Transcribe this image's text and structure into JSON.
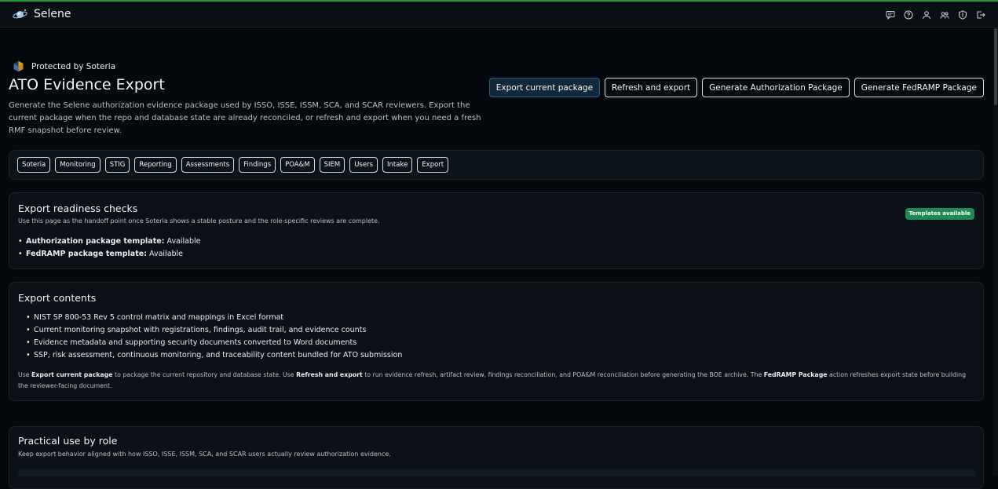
{
  "topbar": {
    "app_name": "Selene",
    "icons": [
      "chat-icon",
      "help-icon",
      "user-icon",
      "users-icon",
      "shield-icon",
      "logout-icon"
    ],
    "accent_color": "#1f9d3a"
  },
  "header": {
    "protected_by": "Protected by Soteria",
    "title": "ATO Evidence Export",
    "description": "Generate the Selene authorization evidence package used by ISSO, ISSE, ISSM, SCA, and SCAR reviewers. Export the current package when the repo and database state are already reconciled, or refresh and export when you need a fresh RMF snapshot before review."
  },
  "actions": {
    "export_current": "Export current package",
    "refresh_export": "Refresh and export",
    "gen_authorization": "Generate Authorization Package",
    "gen_fedramp": "Generate FedRAMP Package"
  },
  "nav_tabs": [
    "Soteria",
    "Monitoring",
    "STIG",
    "Reporting",
    "Assessments",
    "Findings",
    "POA&M",
    "SIEM",
    "Users",
    "Intake",
    "Export"
  ],
  "readiness": {
    "title": "Export readiness checks",
    "subtitle": "Use this page as the handoff point once Soteria shows a stable posture and the role-specific reviews are complete.",
    "badge": "Templates available",
    "badge_color": "#1f8a55",
    "items": [
      {
        "label": "Authorization package template:",
        "value": "Available"
      },
      {
        "label": "FedRAMP package template:",
        "value": "Available"
      }
    ]
  },
  "contents": {
    "title": "Export contents",
    "items": [
      "NIST SP 800-53 Rev 5 control matrix and mappings in Excel format",
      "Current monitoring snapshot with registrations, findings, audit trail, and evidence counts",
      "Evidence metadata and supporting security documents converted to Word documents",
      "SSP, risk assessment, continuous monitoring, and traceability content bundled for ATO submission"
    ],
    "note": {
      "p1": "Use ",
      "b1": "Export current package",
      "p2": " to package the current repository and database state. Use ",
      "b2": "Refresh and export",
      "p3": " to run evidence refresh, artifact review, findings reconciliation, and POA&M reconciliation before generating the BOE archive. The ",
      "b3": "FedRAMP Package",
      "p4": " action refreshes export state before building the reviewer-facing document."
    }
  },
  "roles": {
    "title": "Practical use by role",
    "subtitle": "Keep export behavior aligned with how ISSO, ISSE, ISSM, SCA, and SCAR users actually review authorization evidence."
  }
}
